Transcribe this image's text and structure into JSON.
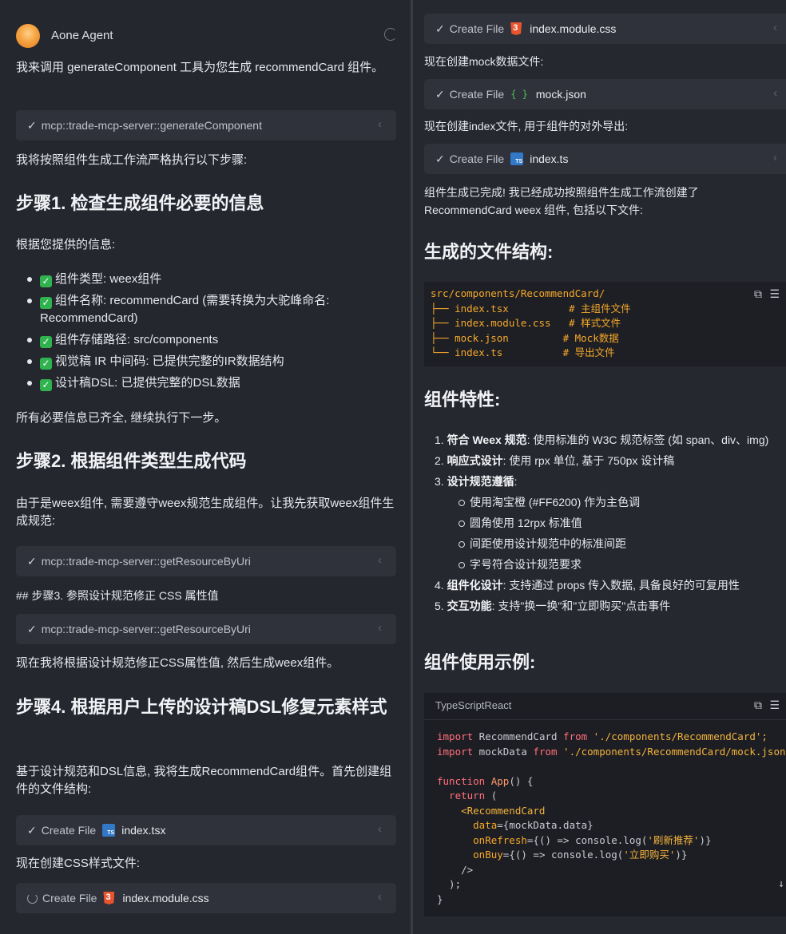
{
  "left": {
    "agent_name": "Aone Agent",
    "intro": "我来调用 generateComponent 工具为您生成 recommendCard 组件。",
    "tool1": "mcp::trade-mcp-server::generateComponent",
    "para1": "我将按照组件生成工作流严格执行以下步骤:",
    "step1": "步骤1. 检查生成组件必要的信息",
    "para2": "根据您提供的信息:",
    "checks": [
      "组件类型: weex组件",
      "组件名称: recommendCard (需要转换为大驼峰命名: RecommendCard)",
      "组件存储路径: src/components",
      "视觉稿 IR 中间码: 已提供完整的IR数据结构",
      "设计稿DSL: 已提供完整的DSL数据"
    ],
    "para3": "所有必要信息已齐全, 继续执行下一步。",
    "step2": "步骤2. 根据组件类型生成代码",
    "para4": "由于是weex组件, 需要遵守weex规范生成组件。让我先获取weex组件生成规范:",
    "tool2": "mcp::trade-mcp-server::getResourceByUri",
    "raw_step3": "## 步骤3. 参照设计规范修正 CSS 属性值",
    "tool3": "mcp::trade-mcp-server::getResourceByUri",
    "para5": "现在我将根据设计规范修正CSS属性值, 然后生成weex组件。",
    "step4": "步骤4. 根据用户上传的设计稿DSL修复元素样式",
    "para6": "基于设计规范和DSL信息, 我将生成RecommendCard组件。首先创建组件的文件结构:",
    "create_label": "Create File",
    "file1": "index.tsx",
    "para7": "现在创建CSS样式文件:",
    "file2": "index.module.css"
  },
  "right": {
    "create_label": "Create File",
    "file_css": "index.module.css",
    "para_mock": "现在创建mock数据文件:",
    "file_json": "mock.json",
    "para_index": "现在创建index文件, 用于组件的对外导出:",
    "file_ts": "index.ts",
    "done": "组件生成已完成! 我已经成功按照组件生成工作流创建了 RecommendCard weex 组件, 包括以下文件:",
    "h_structure": "生成的文件结构:",
    "tree": [
      "src/components/RecommendCard/",
      "├── index.tsx          # 主组件文件",
      "├── index.module.css   # 样式文件",
      "├── mock.json         # Mock数据",
      "└── index.ts          # 导出文件"
    ],
    "h_features": "组件特性:",
    "features": {
      "f1b": "符合 Weex 规范",
      "f1": ": 使用标准的 W3C 规范标签 (如 span、div、img)",
      "f2b": "响应式设计",
      "f2": ": 使用 rpx 单位, 基于 750px 设计稿",
      "f3b": "设计规范遵循",
      "f3": ":",
      "sub": [
        "使用淘宝橙 (#FF6200) 作为主色调",
        "圆角使用 12rpx 标准值",
        "间距使用设计规范中的标准间距",
        "字号符合设计规范要求"
      ],
      "f4b": "组件化设计",
      "f4": ": 支持通过 props 传入数据, 具备良好的可复用性",
      "f5b": "交互功能",
      "f5": ": 支持\"换一换\"和\"立即购买\"点击事件"
    },
    "h_usage": "组件使用示例:",
    "code_lang": "TypeScriptReact",
    "code": {
      "l1a": "import",
      "l1b": " RecommendCard ",
      "l1c": "from",
      "l1d": " './components/RecommendCard';",
      "l2a": "import",
      "l2b": " mockData ",
      "l2c": "from",
      "l2d": " './components/RecommendCard/mock.json",
      "l3a": "function",
      "l3b": " App",
      "l3c": "() {",
      "l4a": "  return",
      "l4b": " (",
      "l5": "    <RecommendCard",
      "l6a": "      data",
      "l6b": "={mockData.data}",
      "l7a": "      onRefresh",
      "l7b": "={() => console.log(",
      "l7c": "'刷新推荐'",
      "l7d": ")}",
      "l8a": "      onBuy",
      "l8b": "={() => console.log(",
      "l8c": "'立即购买'",
      "l8d": ")}",
      "l9": "    />",
      "l10": "  );",
      "l11": "}"
    }
  }
}
